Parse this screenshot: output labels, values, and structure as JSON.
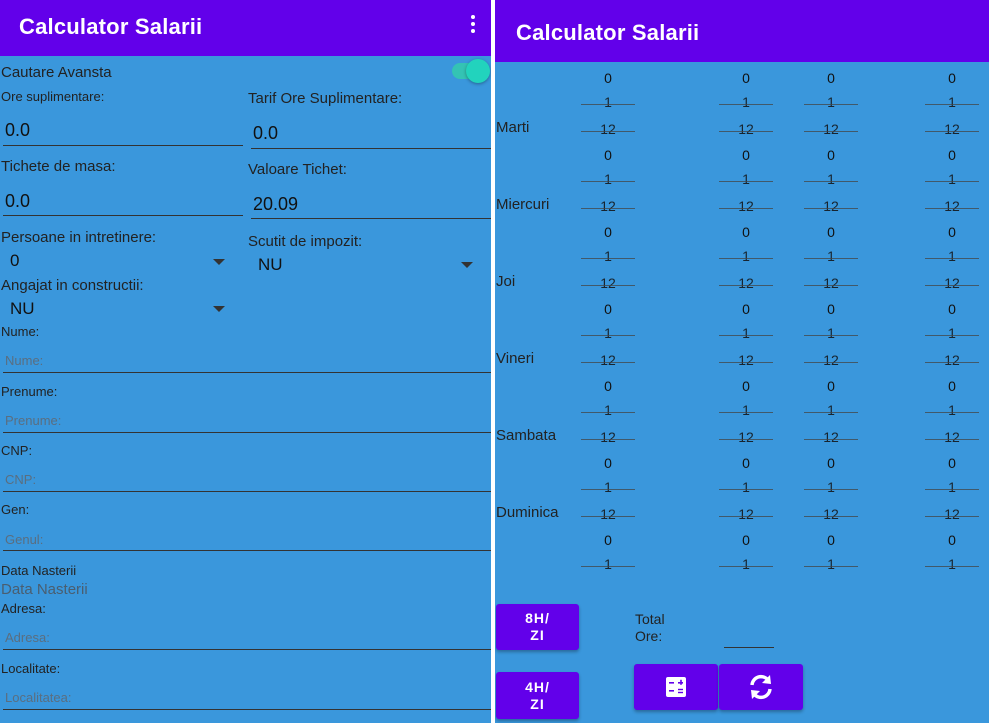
{
  "left": {
    "appbar": {
      "title": "Calculator Salarii"
    },
    "toggle": {
      "label": "Cautare Avansta",
      "on": true
    },
    "ore_suplimentare": {
      "label": "Ore suplimentare:",
      "value": "0.0"
    },
    "tarif_ore": {
      "label": "Tarif Ore Suplimentare:",
      "value": "0.0"
    },
    "tichete_masa": {
      "label": "Tichete de masa:",
      "value": "0.0"
    },
    "valoare_tichet": {
      "label": "Valoare Tichet:",
      "value": "20.09"
    },
    "persoane_intretinere": {
      "label": "Persoane in intretinere:",
      "value": "0"
    },
    "scutit_impozit": {
      "label": "Scutit de impozit:",
      "value": "NU"
    },
    "angajat_constructii": {
      "label": "Angajat in constructii:",
      "value": "NU"
    },
    "nume": {
      "label": "Nume:",
      "placeholder": "Nume:"
    },
    "prenume": {
      "label": "Prenume:",
      "placeholder": "Prenume:"
    },
    "cnp": {
      "label": "CNP:",
      "placeholder": "CNP:"
    },
    "gen": {
      "label": "Gen:",
      "placeholder": "Genul:"
    },
    "data_nasterii": {
      "label": "Data Nasterii",
      "value": "Data Nasterii"
    },
    "adresa": {
      "label": "Adresa:",
      "placeholder": "Adresa:"
    },
    "localitate": {
      "label": "Localitate:",
      "placeholder": "Localitatea:"
    }
  },
  "right": {
    "appbar": {
      "title": "Calculator Salarii"
    },
    "picker": {
      "top": "0",
      "mid": "1",
      "bottom": "12"
    },
    "days": [
      "Marti",
      "Miercuri",
      "Joi",
      "Vineri",
      "Sambata",
      "Duminica"
    ],
    "btn_8h": "8H/\nZI",
    "btn_4h": "4H/\nZI",
    "total_label": "Total\nOre:",
    "calc_icon": "calculator-icon",
    "refresh_icon": "refresh-icon"
  }
}
